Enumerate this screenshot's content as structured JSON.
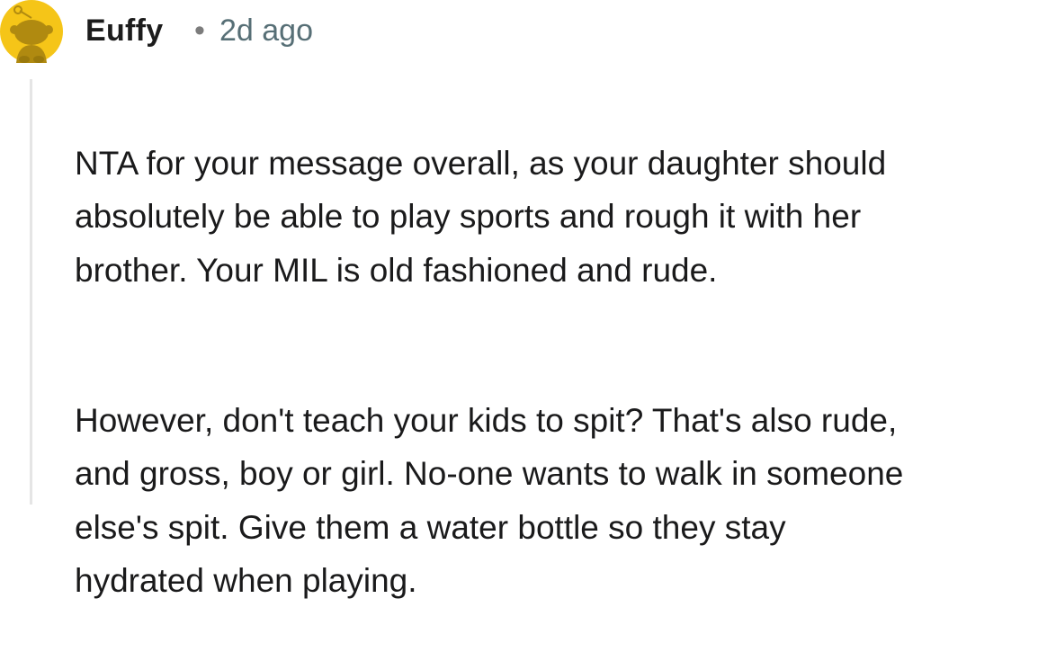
{
  "comment": {
    "author": "Euffy",
    "separator": "•",
    "timestamp": "2d ago",
    "avatar_icon": "snoo-avatar-icon",
    "avatar_color": "#F5C518",
    "paragraphs": [
      "NTA for your message overall, as your daughter should\nabsolutely be able to play sports and rough it with her\nbrother. Your MIL is old fashioned and rude.",
      "However, don't teach your kids to spit? That's also rude,\nand gross, boy or girl. No-one wants to walk in someone\nelse's spit. Give them a water bottle so they stay\nhydrated when playing."
    ]
  }
}
